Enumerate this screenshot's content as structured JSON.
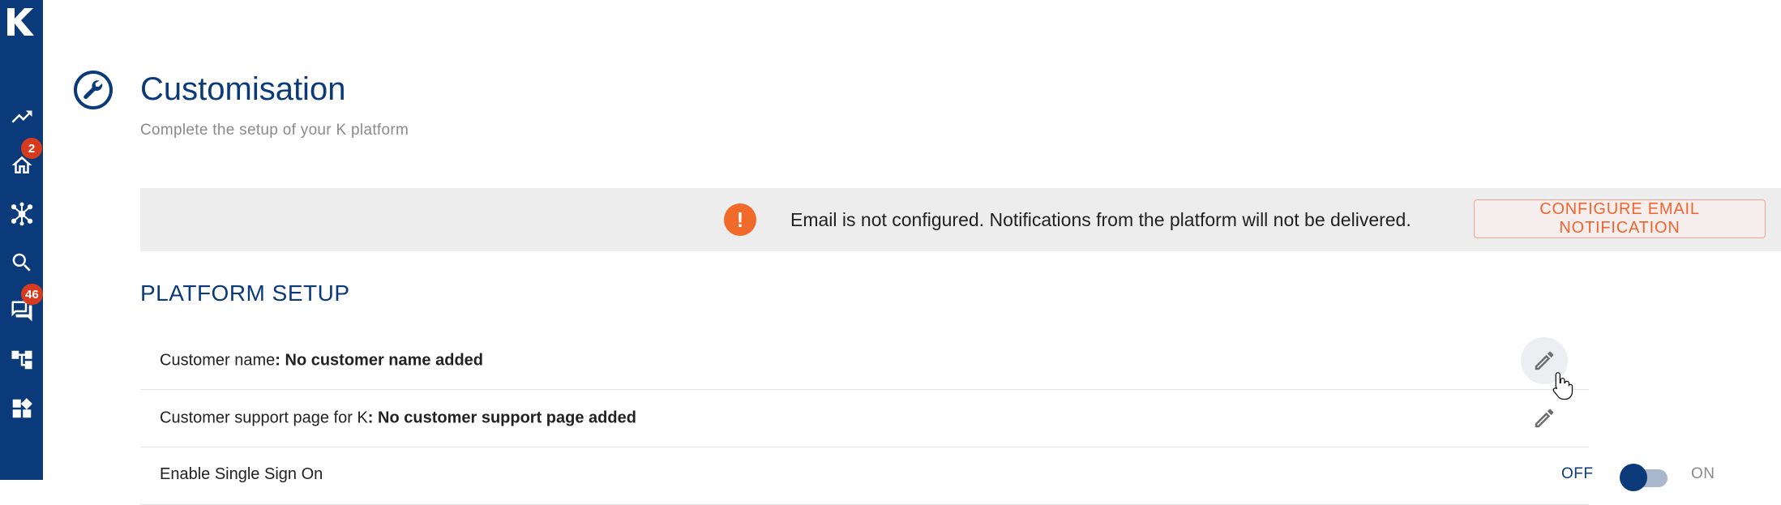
{
  "sidebar": {
    "logo_letter": "K",
    "items": [
      {
        "name": "analytics",
        "icon": "trending-up-icon"
      },
      {
        "name": "home",
        "icon": "home-icon",
        "badge": "2"
      },
      {
        "name": "network",
        "icon": "hub-icon"
      },
      {
        "name": "search",
        "icon": "search-icon"
      },
      {
        "name": "messages",
        "icon": "forum-icon",
        "badge": "46"
      },
      {
        "name": "hierarchy",
        "icon": "account-tree-icon"
      },
      {
        "name": "widgets",
        "icon": "widgets-icon"
      }
    ]
  },
  "header": {
    "title": "Customisation",
    "subtitle": "Complete the setup of your K platform",
    "icon": "wrench-icon"
  },
  "banner": {
    "icon_glyph": "!",
    "message": "Email is not configured. Notifications from the platform will not be delivered.",
    "button_label": "CONFIGURE EMAIL NOTIFICATION",
    "accent_color": "#f26a2b"
  },
  "section": {
    "title": "PLATFORM SETUP",
    "rows": [
      {
        "label": "Customer name",
        "value": ": No customer name added"
      },
      {
        "label": "Customer support page for K",
        "value": ": No customer support page added"
      },
      {
        "label": "Enable Single Sign On",
        "toggle_off": "OFF",
        "toggle_on": "ON",
        "toggle_state": "off"
      }
    ]
  },
  "colors": {
    "primary": "#0b3a7a",
    "badge": "#d63b1f"
  }
}
